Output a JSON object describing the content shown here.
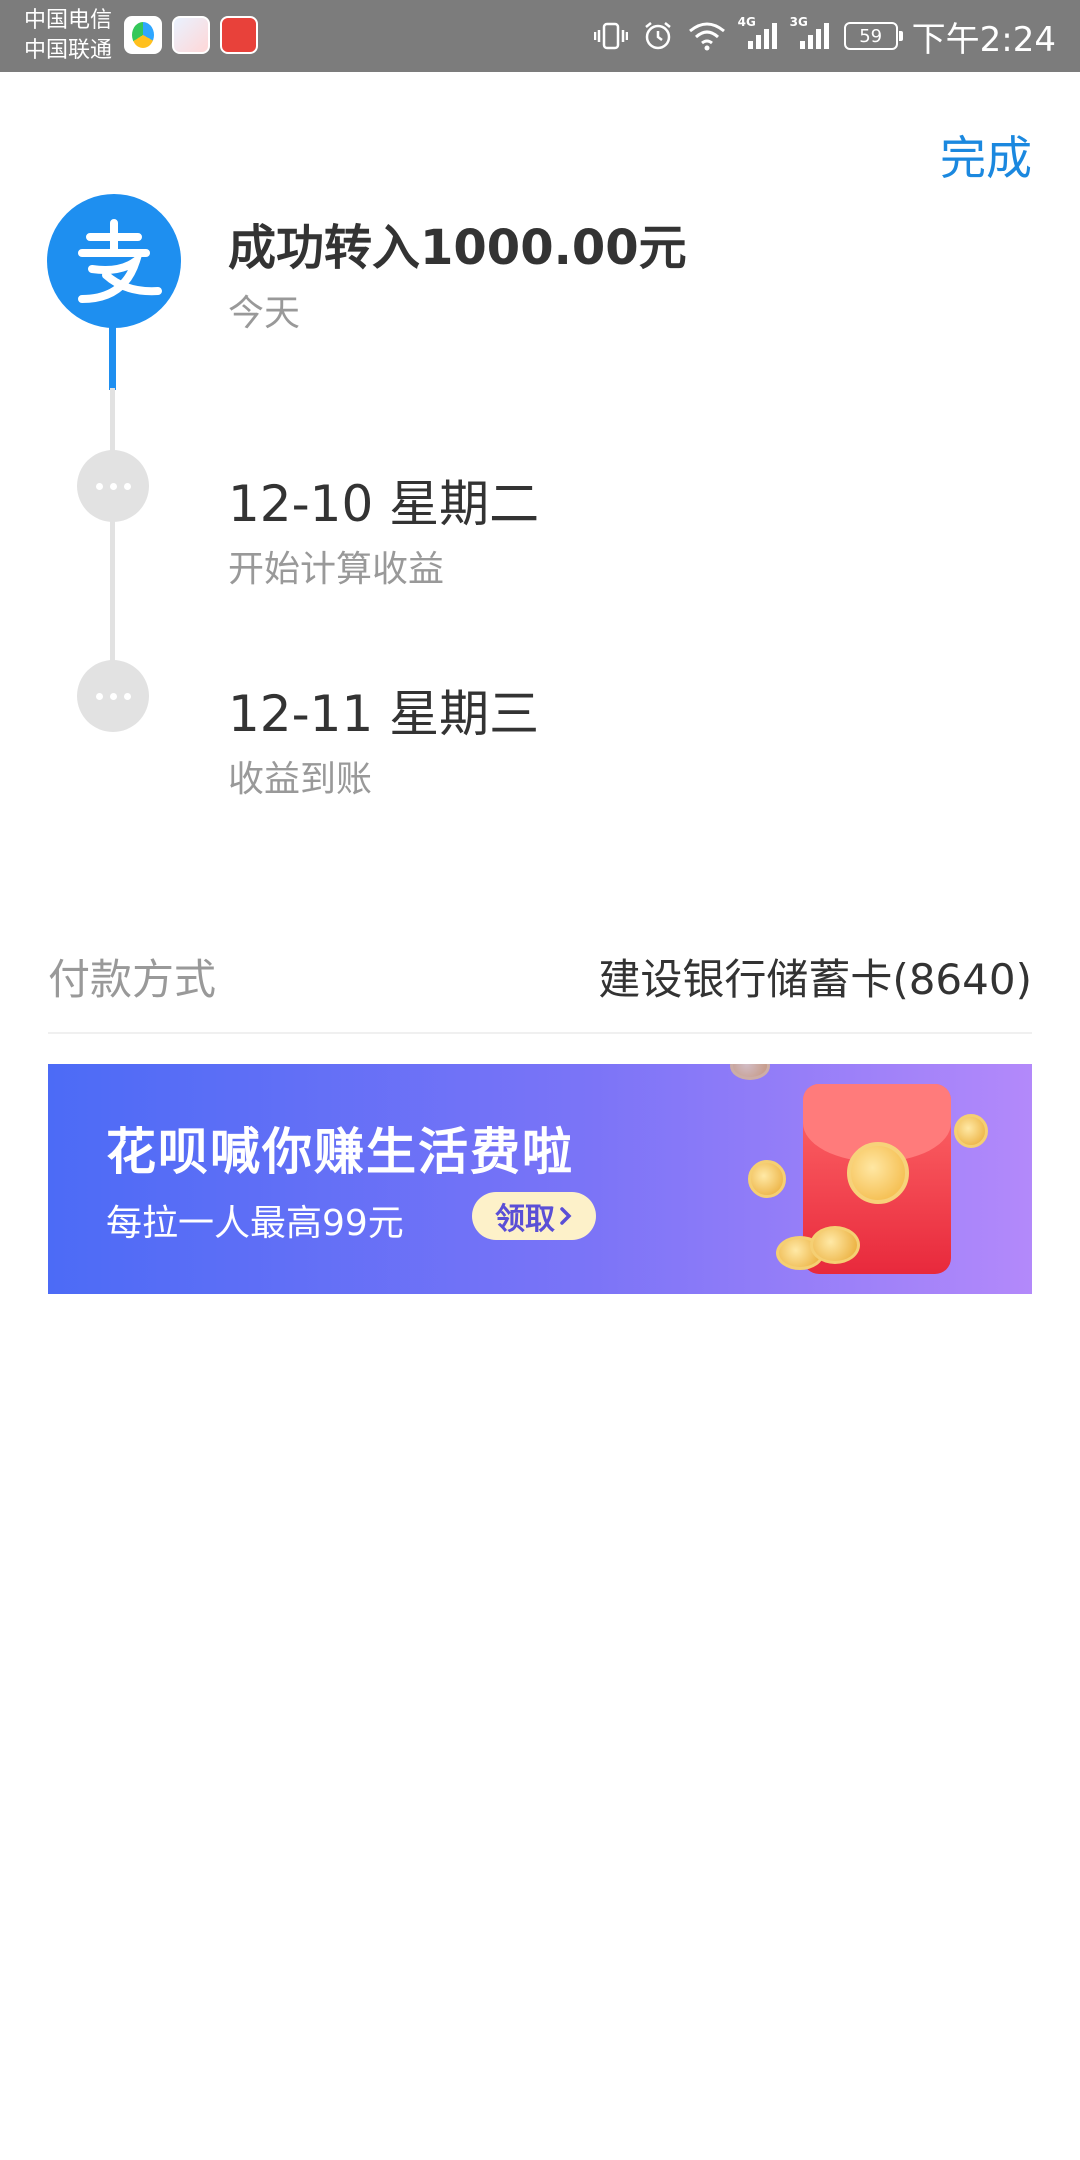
{
  "status_bar": {
    "carrier_1": "中国电信",
    "carrier_2": "中国联通",
    "signal_1_tag": "4G",
    "signal_2_tag": "3G",
    "battery": "59",
    "time": "下午2:24"
  },
  "header": {
    "done_label": "完成"
  },
  "timeline": {
    "steps": [
      {
        "title": "成功转入1000.00元",
        "subtitle": "今天"
      },
      {
        "title": "12-10 星期二",
        "subtitle": "开始计算收益"
      },
      {
        "title": "12-11 星期三",
        "subtitle": "收益到账"
      }
    ]
  },
  "payment": {
    "label": "付款方式",
    "value": "建设银行储蓄卡(8640)"
  },
  "banner": {
    "title": "花呗喊你赚生活费啦",
    "subtitle": "每拉一人最高99元",
    "button_label": "领取"
  },
  "colors": {
    "accent": "#1b88df",
    "alipay_blue": "#1e8ff0",
    "banner_start": "#4c6bf6",
    "banner_end": "#b389fa"
  }
}
